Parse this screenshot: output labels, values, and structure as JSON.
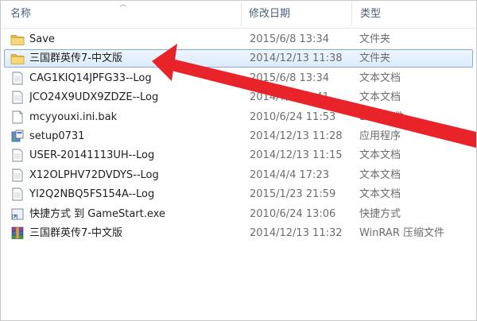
{
  "columns": {
    "name": "名称",
    "date": "修改日期",
    "type": "类型"
  },
  "files": [
    {
      "name": "Save",
      "date": "2015/6/8 13:34",
      "type": "文件夹",
      "icon": "folder-icon"
    },
    {
      "name": "三国群英传7-中文版",
      "date": "2014/12/13 11:38",
      "type": "文件夹",
      "icon": "folder-icon",
      "selected": true
    },
    {
      "name": "CAG1KIQ14JPFG33--Log",
      "date": "2015/6/8 13:34",
      "type": "文本文档",
      "icon": "text-file-icon"
    },
    {
      "name": "JCO24X9UDX9ZDZE--Log",
      "date": "2014/7/4 12:41",
      "type": "文本文档",
      "icon": "text-file-icon"
    },
    {
      "name": "mcyyouxi.ini.bak",
      "date": "2010/6/24 11:53",
      "type": "BAK 文件",
      "icon": "generic-file-icon"
    },
    {
      "name": "setup0731",
      "date": "2014/12/13 11:28",
      "type": "应用程序",
      "icon": "setup-app-icon"
    },
    {
      "name": "USER-20141113UH--Log",
      "date": "2014/12/13 11:15",
      "type": "文本文档",
      "icon": "text-file-icon"
    },
    {
      "name": "X12OLPHV72DVDYS--Log",
      "date": "2014/4/4 17:23",
      "type": "文本文档",
      "icon": "text-file-icon"
    },
    {
      "name": "YI2Q2NBQ5FS154A--Log",
      "date": "2015/1/23 21:59",
      "type": "文本文档",
      "icon": "text-file-icon"
    },
    {
      "name": "快捷方式 到 GameStart.exe",
      "date": "2010/6/24 13:06",
      "type": "快捷方式",
      "icon": "shortcut-icon"
    },
    {
      "name": "三国群英传7-中文版",
      "date": "2014/12/13 11:32",
      "type": "WinRAR 压缩文件",
      "icon": "winrar-archive-icon"
    }
  ],
  "colors": {
    "selection_border": "#84acdd",
    "annotation_arrow": "#e8242a"
  }
}
